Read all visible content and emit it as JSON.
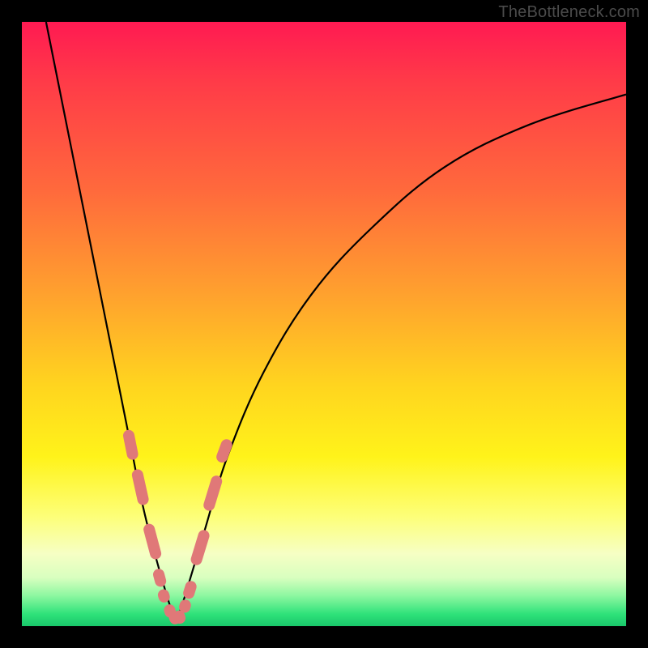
{
  "attribution": "TheBottleneck.com",
  "colors": {
    "frame": "#000000",
    "gradient_top": "#ff1a52",
    "gradient_bottom": "#19c76a",
    "curve": "#000000",
    "bead": "#e07878"
  },
  "chart_data": {
    "type": "line",
    "title": "",
    "xlabel": "",
    "ylabel": "",
    "xlim": [
      0,
      100
    ],
    "ylim": [
      0,
      100
    ],
    "note": "Axes unlabeled in source image; x and y are normalized 0–100. Two black curves descending from top edges, meeting near the bottom around x≈25, with salmon-colored rounded-rectangular markers clustered near the trough on both branches.",
    "series": [
      {
        "name": "left-curve",
        "x": [
          4,
          6,
          8,
          10,
          12,
          14,
          16,
          18,
          20,
          22,
          24,
          25.5
        ],
        "y": [
          100,
          90,
          80,
          70,
          60,
          50,
          40,
          30,
          20,
          12,
          5,
          0.5
        ]
      },
      {
        "name": "right-curve",
        "x": [
          25.5,
          27,
          30,
          34,
          40,
          48,
          58,
          70,
          84,
          100
        ],
        "y": [
          0.5,
          5,
          15,
          28,
          42,
          55,
          66,
          76,
          83,
          88
        ]
      }
    ],
    "markers": {
      "name": "beads",
      "shape": "rounded-rect",
      "color": "#e07878",
      "points": [
        {
          "x": 18.0,
          "y": 30,
          "len": 5
        },
        {
          "x": 19.6,
          "y": 23,
          "len": 6
        },
        {
          "x": 21.6,
          "y": 14,
          "len": 6
        },
        {
          "x": 22.8,
          "y": 8,
          "len": 3
        },
        {
          "x": 23.5,
          "y": 5,
          "len": 2.2
        },
        {
          "x": 24.5,
          "y": 2.5,
          "len": 2.2
        },
        {
          "x": 25.3,
          "y": 1.4,
          "len": 2.2
        },
        {
          "x": 26.1,
          "y": 1.5,
          "len": 2.2
        },
        {
          "x": 27.0,
          "y": 3.3,
          "len": 2.2
        },
        {
          "x": 27.8,
          "y": 6,
          "len": 3
        },
        {
          "x": 29.5,
          "y": 13,
          "len": 6
        },
        {
          "x": 31.6,
          "y": 22,
          "len": 6
        },
        {
          "x": 33.5,
          "y": 29,
          "len": 4
        }
      ]
    }
  }
}
